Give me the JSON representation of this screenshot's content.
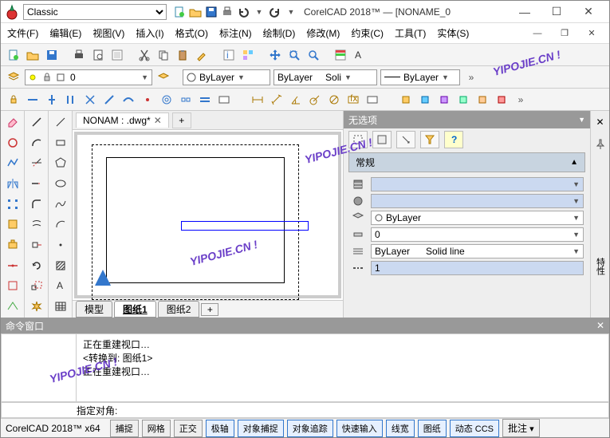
{
  "workspace_selector": "Classic",
  "apptitle": "CorelCAD 2018™ — [NONAME_0",
  "menus": [
    "文件(F)",
    "编辑(E)",
    "视图(V)",
    "插入(I)",
    "格式(O)",
    "标注(N)",
    "绘制(D)",
    "修改(M)",
    "约束(C)",
    "工具(T)",
    "实体(S)"
  ],
  "layer_input_value": "0",
  "layer_combo1": "ByLayer",
  "layer_combo2_a": "ByLayer",
  "layer_combo2_b": "Soli",
  "layer_combo3": "ByLayer",
  "doctab": "NONAM : .dwg*",
  "model_tabs": [
    "模型",
    "图纸1",
    "图纸2"
  ],
  "prop_header": "无选项",
  "prop_section": "常规",
  "prop_bylayer": "ByLayer",
  "prop_zero": "0",
  "prop_linetype_a": "ByLayer",
  "prop_linetype_b": "Solid line",
  "prop_one": "1",
  "cmd_title": "命令窗口",
  "cmd_lines": [
    "正在重建视口…",
    "",
    "<转换到: 图纸1>",
    "正在重建视口…"
  ],
  "cmd_prompt": "指定对角:",
  "status_app": "CorelCAD 2018™ x64",
  "status_btns": [
    {
      "label": "捕捉",
      "active": false
    },
    {
      "label": "网格",
      "active": false
    },
    {
      "label": "正交",
      "active": false
    },
    {
      "label": "极轴",
      "active": true
    },
    {
      "label": "对象捕捉",
      "active": true
    },
    {
      "label": "对象追踪",
      "active": true
    },
    {
      "label": "快速输入",
      "active": true
    },
    {
      "label": "线宽",
      "active": true
    },
    {
      "label": "图纸",
      "active": true
    },
    {
      "label": "动态 CCS",
      "active": true
    },
    {
      "label": "批注",
      "active": false
    }
  ],
  "watermark": "YIPOJIE.CN !"
}
